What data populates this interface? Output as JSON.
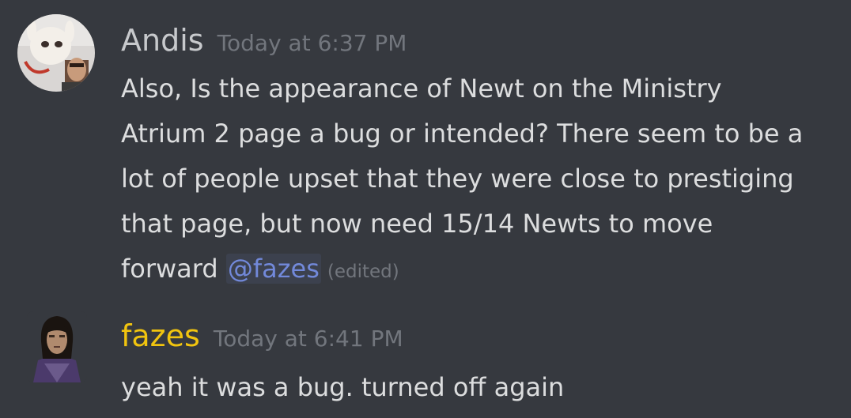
{
  "messages": [
    {
      "username": "Andis",
      "timestamp": "Today at 6:37 PM",
      "lines": [
        "Also, Is the appearance of Newt on the Ministry",
        "Atrium 2 page a bug or intended? There seem to be a",
        "lot of people upset that they were close to prestiging",
        "that page, but now need 15/14 Newts to move"
      ],
      "last_line_prefix": "forward ",
      "mention": "@fazes",
      "edited": "(edited)",
      "avatar_icon": "user-avatar-photo"
    },
    {
      "username": "fazes",
      "timestamp": "Today at 6:41 PM",
      "lines": [
        "yeah it was a bug. turned off again"
      ],
      "avatar_icon": "user-avatar-character",
      "username_color": "#f1c40f"
    }
  ],
  "colors": {
    "background": "#36393f",
    "text": "#dcddde",
    "timestamp": "#72767d",
    "mention": "#7289da"
  }
}
